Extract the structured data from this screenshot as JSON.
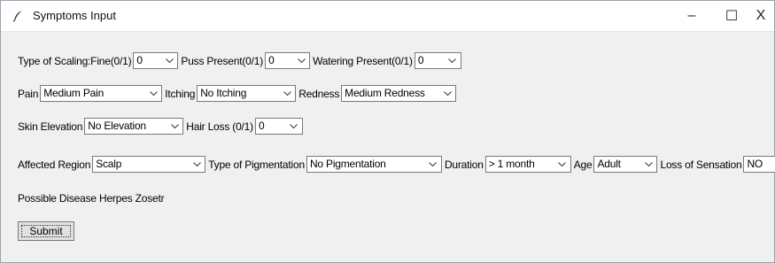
{
  "window": {
    "title": "Symptoms Input",
    "minimize_label": "–",
    "maximize_label": "☐",
    "close_label": "X"
  },
  "form": {
    "scaling_label": "Type of Scaling:Fine(0/1)",
    "scaling_value": "0",
    "puss_label": "Puss Present(0/1)",
    "puss_value": "0",
    "watering_label": "Watering Present(0/1)",
    "watering_value": "0",
    "pain_label": "Pain",
    "pain_value": "Medium Pain",
    "itching_label": "Itching",
    "itching_value": "No Itching",
    "redness_label": "Redness",
    "redness_value": "Medium Redness",
    "elevation_label": "Skin Elevation",
    "elevation_value": "No Elevation",
    "hairloss_label": "Hair Loss (0/1)",
    "hairloss_value": "0",
    "region_label": "Affected Region",
    "region_value": "Scalp",
    "pigmentation_label": "Type of Pigmentation",
    "pigmentation_value": "No Pigmentation",
    "duration_label": "Duration",
    "duration_value": "> 1 month",
    "age_label": "Age",
    "age_value": "Adult",
    "sensation_label": "Loss of Sensation",
    "sensation_value": "NO"
  },
  "result": {
    "text": "Possible Disease Herpes Zosetr"
  },
  "submit_label": "Submit",
  "colors": {
    "window_bg": "#f0f0f0",
    "titlebar_bg": "#ffffff",
    "field_border": "#7a7a7a"
  }
}
